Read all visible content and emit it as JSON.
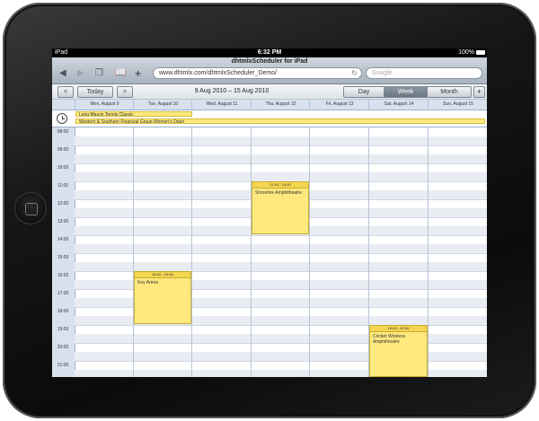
{
  "status": {
    "carrier": "iPad",
    "time": "6:32 PM",
    "battery": "100%"
  },
  "browser": {
    "title": "dhtmlxScheduler for iPad",
    "url": "www.dhtmlx.com/dhtmlxScheduler_Demo/",
    "search_placeholder": "Google"
  },
  "toolbar": {
    "prev": "<",
    "today": "Today",
    "next": ">",
    "range": "9 Aug 2010 – 15 Aug 2010",
    "views": [
      "Day",
      "Week",
      "Month"
    ],
    "active_view": "Week",
    "add": "+"
  },
  "days": [
    "Mon, August 9",
    "Tue, August 10",
    "Wed, August 11",
    "Thu, August 12",
    "Fri, August 13",
    "Sat, August 14",
    "Sun, August 15"
  ],
  "hours": [
    "08:00",
    "09:00",
    "10:00",
    "11:00",
    "12:00",
    "13:00",
    "14:00",
    "15:00",
    "16:00",
    "17:00",
    "18:00",
    "19:00",
    "20:00",
    "21:00"
  ],
  "multiday_events": [
    {
      "text": "Legg Mason Tennis Classic"
    },
    {
      "text": "Western & Southern Financial Group Women's Open"
    }
  ],
  "events": [
    {
      "time": "11:00 - 14:00",
      "text": "Shoreline Amphitheatre"
    },
    {
      "time": "16:00 - 19:00",
      "text": "Key Arena"
    },
    {
      "time": "19:00 - 22:00",
      "text": "Cricket Wireless Amphitheatre"
    }
  ]
}
